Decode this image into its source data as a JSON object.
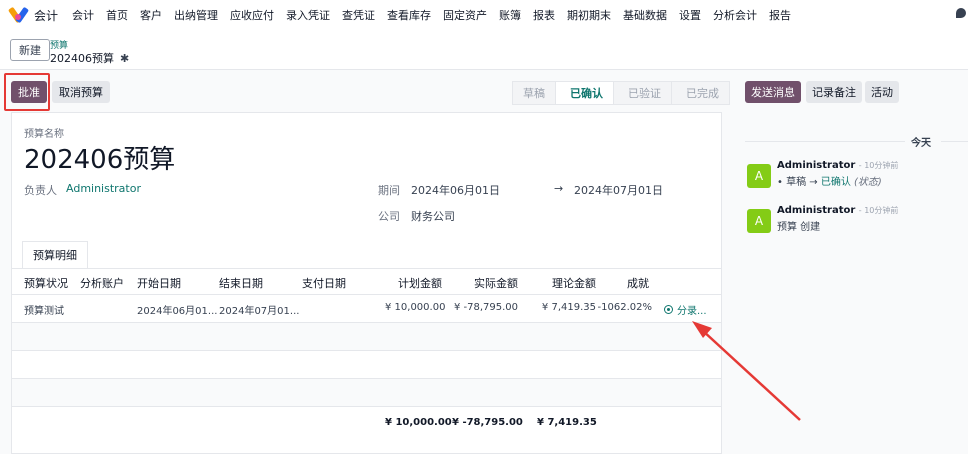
{
  "topnav": {
    "app_name": "会计",
    "items": [
      "会计",
      "首页",
      "客户",
      "出纳管理",
      "应收应付",
      "录入凭证",
      "查凭证",
      "查看库存",
      "固定资产",
      "账簿",
      "报表",
      "期初期末",
      "基础数据",
      "设置",
      "分析会计",
      "报告"
    ]
  },
  "breadcrumb": {
    "new_label": "新建",
    "parent": "预算",
    "current": "202406预算"
  },
  "actions": {
    "approve": "批准",
    "cancel": "取消预算"
  },
  "pipeline": {
    "stages": [
      "草稿",
      "已确认",
      "已验证",
      "已完成"
    ],
    "active_index": 1
  },
  "form": {
    "name_label": "预算名称",
    "name": "202406预算",
    "responsible_label": "负责人",
    "responsible": "Administrator",
    "period_label": "期间",
    "period_start": "2024年06月01日",
    "period_arrow": "→",
    "period_end": "2024年07月01日",
    "company_label": "公司",
    "company": "财务公司"
  },
  "tabs": {
    "budget_lines": "预算明细"
  },
  "table": {
    "headers": [
      "预算状况",
      "分析账户",
      "开始日期",
      "结束日期",
      "支付日期",
      "计划金额",
      "实际金额",
      "理论金额",
      "成就"
    ],
    "rows": [
      {
        "status": "预算测试",
        "analytic": "",
        "start": "2024年06月01...",
        "end": "2024年07月01...",
        "paid": "",
        "planned": "¥ 10,000.00",
        "actual": "¥ -78,795.00",
        "theoretical": "¥ 7,419.35",
        "achievement": "-1062.02%",
        "entries_label": "分录..."
      }
    ],
    "totals": {
      "planned": "¥ 10,000.00",
      "actual": "¥ -78,795.00",
      "theoretical": "¥ 7,419.35"
    }
  },
  "chatter": {
    "send_message": "发送消息",
    "log_note": "记录备注",
    "activity": "活动",
    "day_label": "今天",
    "messages": [
      {
        "avatar": "A",
        "author": "Administrator",
        "time": "- 10分钟前",
        "old_value": "草稿",
        "arrow": "→",
        "new_value": "已确认",
        "field": "(状态)"
      },
      {
        "avatar": "A",
        "author": "Administrator",
        "time": "- 10分钟前",
        "body": "预算 创建"
      }
    ]
  },
  "colors": {
    "primary": "#71506b",
    "link": "#0f766e",
    "annotation": "#e53935",
    "avatar": "#84cc16"
  }
}
